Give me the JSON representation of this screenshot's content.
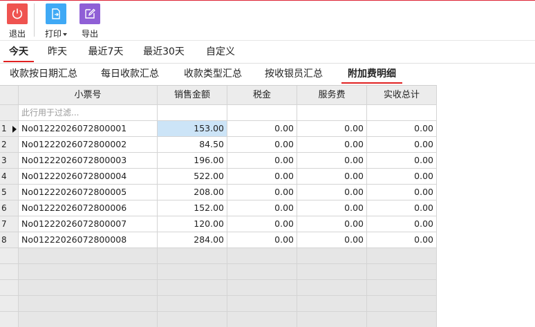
{
  "toolbar": {
    "exit_label": "退出",
    "print_label": "打印",
    "export_label": "导出",
    "colors": {
      "exit": "#ef5350",
      "print": "#3fa9f5",
      "export": "#8f5fd6"
    }
  },
  "date_tabs": [
    "今天",
    "昨天",
    "最近7天",
    "最近30天",
    "自定义"
  ],
  "date_active": "今天",
  "report_tabs": [
    "收款按日期汇总",
    "每日收款汇总",
    "收款类型汇总",
    "按收银员汇总",
    "附加费明细"
  ],
  "report_active": "附加费明细",
  "grid": {
    "columns": [
      "小票号",
      "销售金额",
      "税金",
      "服务费",
      "实收总计"
    ],
    "filter_placeholder": "此行用于过滤...",
    "rows": [
      {
        "index": "1",
        "ticket": "No01222026072800001",
        "sales": "153.00",
        "tax": "0.00",
        "service": "0.00",
        "total": "0.00"
      },
      {
        "index": "2",
        "ticket": "No01222026072800002",
        "sales": "84.50",
        "tax": "0.00",
        "service": "0.00",
        "total": "0.00"
      },
      {
        "index": "3",
        "ticket": "No01222026072800003",
        "sales": "196.00",
        "tax": "0.00",
        "service": "0.00",
        "total": "0.00"
      },
      {
        "index": "4",
        "ticket": "No01222026072800004",
        "sales": "522.00",
        "tax": "0.00",
        "service": "0.00",
        "total": "0.00"
      },
      {
        "index": "5",
        "ticket": "No01222026072800005",
        "sales": "208.00",
        "tax": "0.00",
        "service": "0.00",
        "total": "0.00"
      },
      {
        "index": "6",
        "ticket": "No01222026072800006",
        "sales": "152.00",
        "tax": "0.00",
        "service": "0.00",
        "total": "0.00"
      },
      {
        "index": "7",
        "ticket": "No01222026072800007",
        "sales": "120.00",
        "tax": "0.00",
        "service": "0.00",
        "total": "0.00"
      },
      {
        "index": "8",
        "ticket": "No01222026072800008",
        "sales": "284.00",
        "tax": "0.00",
        "service": "0.00",
        "total": "0.00"
      }
    ]
  }
}
